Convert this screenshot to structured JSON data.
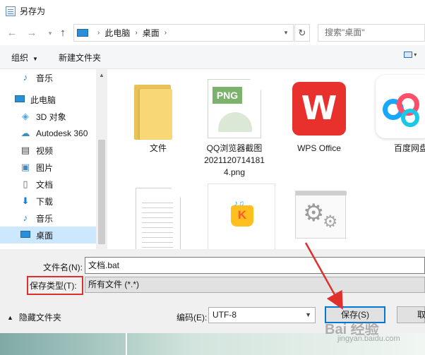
{
  "window": {
    "title": "另存为"
  },
  "address": {
    "crumbs": [
      "此电脑",
      "桌面"
    ],
    "search_placeholder": "搜索\"桌面\""
  },
  "toolbar": {
    "organize_label": "组织",
    "new_folder_label": "新建文件夹"
  },
  "sidebar": {
    "items": [
      {
        "label": "音乐",
        "icon": "music-note-icon"
      },
      {
        "label": "此电脑",
        "icon": "computer-icon"
      },
      {
        "label": "3D 对象",
        "icon": "3d-objects-icon"
      },
      {
        "label": "Autodesk 360",
        "icon": "autodesk-cloud-icon"
      },
      {
        "label": "视频",
        "icon": "video-icon"
      },
      {
        "label": "图片",
        "icon": "pictures-icon"
      },
      {
        "label": "文档",
        "icon": "documents-icon"
      },
      {
        "label": "下载",
        "icon": "download-icon"
      },
      {
        "label": "音乐",
        "icon": "music-note-icon"
      },
      {
        "label": "桌面",
        "icon": "desktop-icon",
        "selected": true
      }
    ]
  },
  "files": [
    {
      "label": "文件",
      "type": "folder"
    },
    {
      "label_lines": [
        "QQ浏览器截图",
        "2021120714181",
        "4.png"
      ],
      "type": "png-image",
      "tag": "PNG"
    },
    {
      "label": "WPS Office",
      "type": "wps-shortcut"
    },
    {
      "label": "百度网盘",
      "type": "baidu-netdisk-shortcut"
    },
    {
      "label": "",
      "type": "text-document"
    },
    {
      "label": "",
      "type": "kugou-shortcut"
    },
    {
      "label": "",
      "type": "settings-file"
    }
  ],
  "form": {
    "filename_label": "文件名(N):",
    "filename_value": "文档.bat",
    "filetype_label": "保存类型(T):",
    "filetype_value": "所有文件 (*.*)",
    "encoding_label": "编码(E):",
    "encoding_value": "UTF-8",
    "hide_folders_label": "隐藏文件夹",
    "save_label": "保存(S)",
    "cancel_label": "取"
  },
  "annotation": {
    "highlight_color": "#e0302c",
    "arrow_color": "#e0302c"
  },
  "watermark": {
    "brand": "Bai 经验",
    "url": "jingyan.baidu.com"
  }
}
